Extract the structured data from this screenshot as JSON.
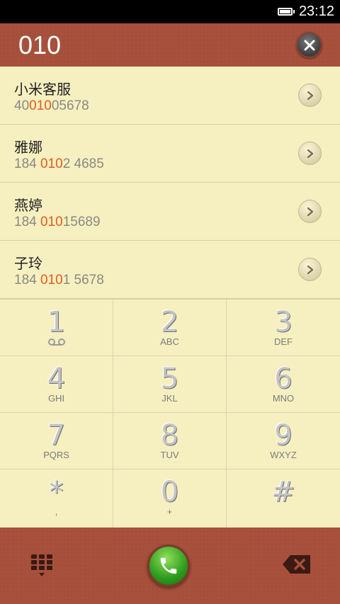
{
  "status_bar": {
    "time": "23:12"
  },
  "header": {
    "dial_number": "010"
  },
  "contacts": [
    {
      "name": "小米客服",
      "number_pre": "40",
      "number_match": "010",
      "number_post": "05678"
    },
    {
      "name": "雅娜",
      "number_pre": "184 ",
      "number_match": "010",
      "number_post": "2 4685"
    },
    {
      "name": "燕婷",
      "number_pre": "184 ",
      "number_match": "010",
      "number_post": "15689"
    },
    {
      "name": "子玲",
      "number_pre": "184 ",
      "number_match": "010",
      "number_post": "1 5678"
    }
  ],
  "keypad": [
    {
      "digit": "1",
      "letters": ""
    },
    {
      "digit": "2",
      "letters": "ABC"
    },
    {
      "digit": "3",
      "letters": "DEF"
    },
    {
      "digit": "4",
      "letters": "GHI"
    },
    {
      "digit": "5",
      "letters": "JKL"
    },
    {
      "digit": "6",
      "letters": "MNO"
    },
    {
      "digit": "7",
      "letters": "PQRS"
    },
    {
      "digit": "8",
      "letters": "TUV"
    },
    {
      "digit": "9",
      "letters": "WXYZ"
    },
    {
      "digit": "*",
      "letters": ","
    },
    {
      "digit": "0",
      "letters": "+"
    },
    {
      "digit": "#",
      "letters": ""
    }
  ],
  "icons": {
    "battery": "battery-icon",
    "clear": "close-icon",
    "contact_detail": "chevron-right-icon",
    "voicemail": "voicemail-icon",
    "keypad_toggle": "dialpad-icon",
    "call": "phone-icon",
    "backspace": "backspace-icon"
  },
  "colors": {
    "header_bg": "#a64f3a",
    "list_bg": "#f6efc0",
    "match_highlight": "#e25d1c",
    "call_green": "#2c9a1c"
  }
}
